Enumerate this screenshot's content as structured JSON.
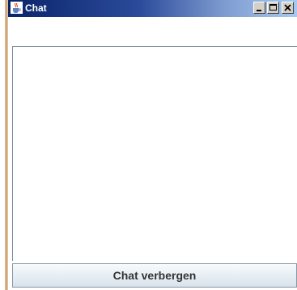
{
  "window": {
    "title": "Chat",
    "app_icon": "java-cup-icon",
    "controls": [
      "minimize-icon",
      "maximize-icon",
      "close-icon"
    ]
  },
  "chat": {
    "messages_text": ""
  },
  "footer": {
    "hide_button_label": "Chat verbergen"
  },
  "colors": {
    "titlebar_start": "#0a246a",
    "titlebar_end": "#a6caf0",
    "window_bg": "#ffffff"
  }
}
